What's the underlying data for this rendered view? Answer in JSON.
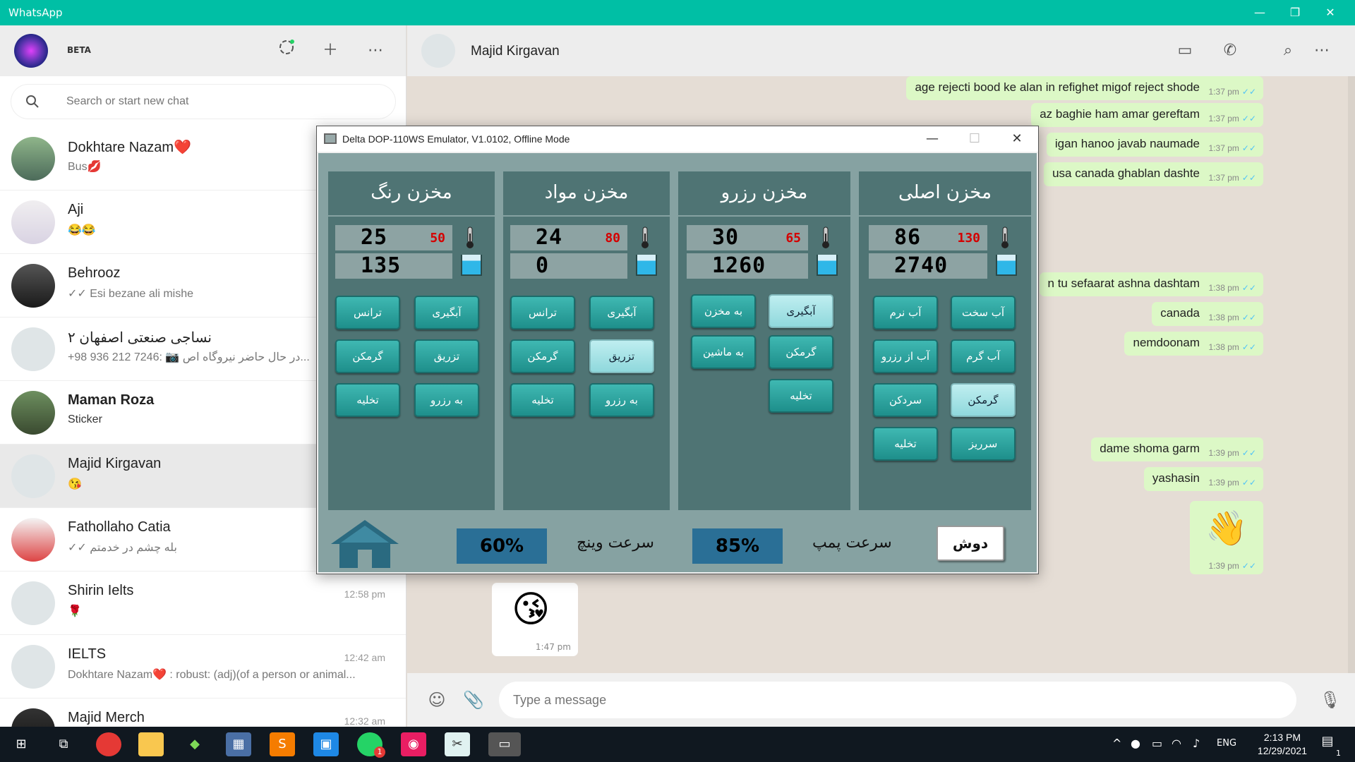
{
  "app": {
    "title": "WhatsApp",
    "window_controls": {
      "minimize": "—",
      "maximize": "❐",
      "close": "✕"
    }
  },
  "sidebar": {
    "profile_badge": "BETA",
    "search_placeholder": "Search or start new chat",
    "chats": [
      {
        "name": "Dokhtare Nazam❤️",
        "preview": "Bus💋",
        "time": ""
      },
      {
        "name": "Aji",
        "preview": "😂😂",
        "time": ""
      },
      {
        "name": "Behrooz",
        "preview": "✓✓ Esi bezane ali mishe",
        "time": ""
      },
      {
        "name": "نساجی صنعتی اصفهان ۲",
        "preview": "+98 936 212 7246: 📷 در حال حاضر نیروگاه اص...",
        "time": ""
      },
      {
        "name": "Maman Roza",
        "preview": "Sticker",
        "time": ""
      },
      {
        "name": "Majid Kirgavan",
        "preview": "😘",
        "time": ""
      },
      {
        "name": "Fathollaho Catia",
        "preview": "✓✓ بله چشم در خدمتم",
        "time": ""
      },
      {
        "name": "Shirin Ielts",
        "preview": "🌹",
        "time": "12:58 pm"
      },
      {
        "name": "IELTS",
        "preview": "Dokhtare Nazam❤️ : robust: (adj)(of a person or animal...",
        "time": "12:42 am"
      },
      {
        "name": "Majid Merch",
        "preview": "",
        "time": "12:32 am"
      }
    ]
  },
  "chat": {
    "contact_name": "Majid Kirgavan",
    "messages": [
      {
        "text": "age rejecti bood ke alan in refighet migof reject shode",
        "time": "1:37 pm"
      },
      {
        "text": "az baghie ham amar gereftam",
        "time": "1:37 pm"
      },
      {
        "text": "igan hanoo javab naumade",
        "time": "1:37 pm"
      },
      {
        "text": "usa canada ghablan dashte",
        "time": "1:37 pm"
      },
      {
        "text": "n tu sefaarat ashna dashtam",
        "time": "1:38 pm"
      },
      {
        "text": "canada",
        "time": "1:38 pm"
      },
      {
        "text": "nemdoonam",
        "time": "1:38 pm"
      },
      {
        "text": "dame shoma garm",
        "time": "1:39 pm"
      },
      {
        "text": "yashasin",
        "time": "1:39 pm"
      },
      {
        "text": "👋",
        "time": "1:39 pm"
      }
    ],
    "incoming": {
      "emoji": "😘",
      "time": "1:47 pm"
    },
    "composer_placeholder": "Type a message"
  },
  "emulator": {
    "title": "Delta DOP-110WS Emulator, V1.0102, Offline Mode",
    "panels": [
      {
        "title": "مخزن رنگ",
        "temp": "25",
        "temp_set": "50",
        "level": "135",
        "buttons": [
          "ترانس",
          "آبگیری",
          "گرمکن",
          "تزریق",
          "تخلیه",
          "به رزرو"
        ],
        "active": []
      },
      {
        "title": "مخزن مواد",
        "temp": "24",
        "temp_set": "80",
        "level": "0",
        "buttons": [
          "ترانس",
          "آبگیری",
          "گرمکن",
          "تزریق",
          "تخلیه",
          "به رزرو"
        ],
        "active": [
          3
        ]
      },
      {
        "title": "مخزن رزرو",
        "temp": "30",
        "temp_set": "65",
        "level": "1260",
        "buttons": [
          "به مخزن",
          "آبگیری",
          "به ماشین",
          "گرمکن",
          "تخلیه"
        ],
        "active": [
          1
        ]
      },
      {
        "title": "مخزن اصلی",
        "temp": "86",
        "temp_set": "130",
        "level": "2740",
        "buttons": [
          "آب نرم",
          "آب سخت",
          "آب از رزرو",
          "آب گرم",
          "سردکن",
          "گرمکن",
          "تخلیه",
          "سرریز"
        ],
        "active": [
          5
        ]
      }
    ],
    "winch_speed_label": "سرعت وینچ",
    "winch_speed": "60%",
    "pump_speed_label": "سرعت پمپ",
    "pump_speed": "85%",
    "doosh_label": "دوش"
  },
  "taskbar": {
    "lang": "ENG",
    "time": "2:13 PM",
    "date": "12/29/2021",
    "notif_count": "1",
    "whatsapp_badge": "1"
  }
}
